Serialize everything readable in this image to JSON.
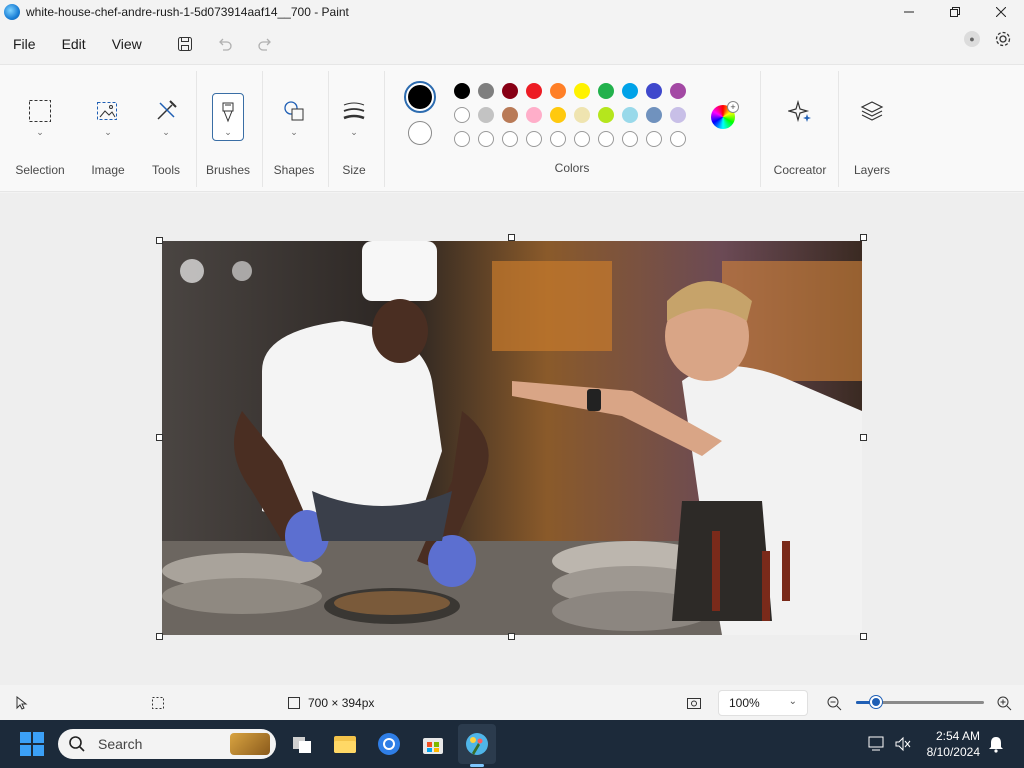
{
  "window": {
    "title": "white-house-chef-andre-rush-1-5d073914aaf14__700 - Paint"
  },
  "menu": {
    "file": "File",
    "edit": "Edit",
    "view": "View"
  },
  "ribbon": {
    "groups": {
      "selection": "Selection",
      "image": "Image",
      "tools": "Tools",
      "brushes": "Brushes",
      "shapes": "Shapes",
      "size": "Size",
      "colors": "Colors",
      "cocreator": "Cocreator",
      "layers": "Layers"
    }
  },
  "palette": {
    "primary": "#000000",
    "secondary": "#ffffff",
    "row1": [
      "#000000",
      "#7f7f7f",
      "#880015",
      "#ed1c24",
      "#ff7f27",
      "#fff200",
      "#22b14c",
      "#00a2e8",
      "#3f48cc",
      "#a349a4"
    ],
    "row2": [
      "#ffffff",
      "#c3c3c3",
      "#b97a57",
      "#ffaec9",
      "#ffc90e",
      "#efe4b0",
      "#b5e61d",
      "#99d9ea",
      "#7092be",
      "#c8bfe7"
    ],
    "row2_first_empty": true,
    "row3_empty_count": 10
  },
  "status": {
    "dimensions": "700 × 394px",
    "zoom": "100%",
    "zoom_level": 0.16
  },
  "taskbar": {
    "search_placeholder": "Search",
    "time": "2:54 AM",
    "date": "8/10/2024"
  }
}
